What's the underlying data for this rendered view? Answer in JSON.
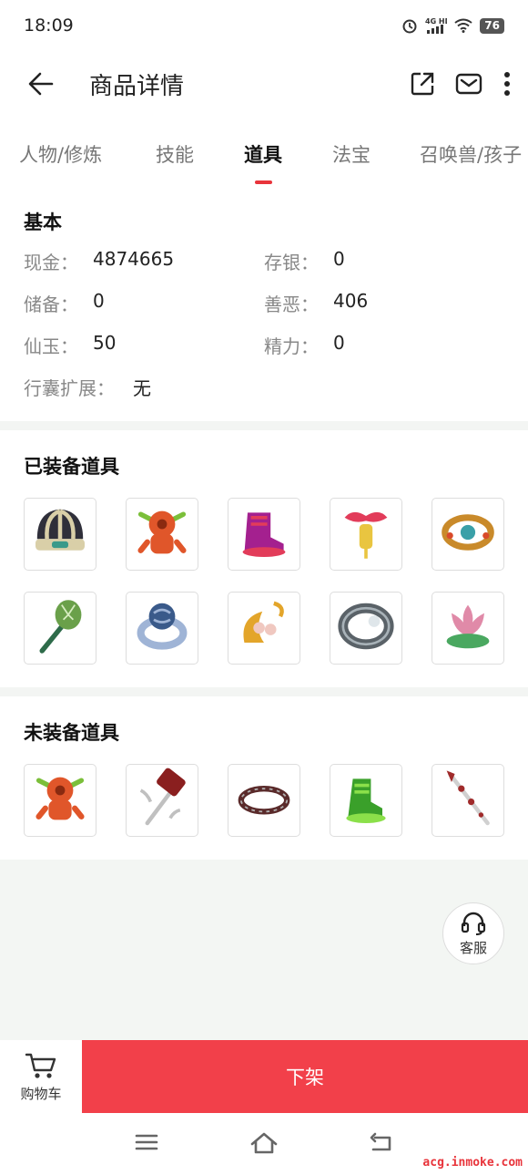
{
  "status_bar": {
    "time": "18:09",
    "network": "4G HD",
    "battery": "76"
  },
  "header": {
    "title": "商品详情"
  },
  "tabs": [
    {
      "label": "人物/修炼"
    },
    {
      "label": "技能"
    },
    {
      "label": "道具"
    },
    {
      "label": "法宝"
    },
    {
      "label": "召唤兽/孩子"
    }
  ],
  "basic": {
    "title": "基本",
    "fields": [
      {
        "label": "现金：",
        "value": "4874665"
      },
      {
        "label": "存银：",
        "value": "0"
      },
      {
        "label": "储备：",
        "value": "0"
      },
      {
        "label": "善恶：",
        "value": "406"
      },
      {
        "label": "仙玉：",
        "value": "50"
      },
      {
        "label": "精力：",
        "value": "0"
      },
      {
        "label": "行囊扩展：",
        "value": "无"
      }
    ]
  },
  "equipped": {
    "title": "已装备道具",
    "items": [
      {
        "icon": "helmet-icon",
        "colors": [
          "#2f2f3a",
          "#d9cfa8"
        ]
      },
      {
        "icon": "beast-totem-icon",
        "colors": [
          "#e0562a",
          "#7bbf3a"
        ]
      },
      {
        "icon": "boots-icon",
        "colors": [
          "#a4208f",
          "#e23c5a"
        ]
      },
      {
        "icon": "pendant-icon",
        "colors": [
          "#e23c5a",
          "#e9c540"
        ]
      },
      {
        "icon": "bracelet-icon",
        "colors": [
          "#c98a2a",
          "#3aa0a8"
        ]
      },
      {
        "icon": "scepter-icon",
        "colors": [
          "#6aa04a",
          "#2e6b4a"
        ]
      },
      {
        "icon": "ring-blue-icon",
        "colors": [
          "#3a5a8a",
          "#9fb4d6"
        ]
      },
      {
        "icon": "earrings-icon",
        "colors": [
          "#e3a52a",
          "#f0c8c0"
        ]
      },
      {
        "icon": "ring-silver-icon",
        "colors": [
          "#5a6268",
          "#a8b2b8"
        ]
      },
      {
        "icon": "lotus-icon",
        "colors": [
          "#e08aa8",
          "#4aa860"
        ]
      }
    ]
  },
  "unequipped": {
    "title": "未装备道具",
    "items": [
      {
        "icon": "beast-totem-icon",
        "colors": [
          "#e0562a",
          "#7bbf3a"
        ]
      },
      {
        "icon": "hammer-icon",
        "colors": [
          "#8a1f1f",
          "#c0c0c0"
        ]
      },
      {
        "icon": "ring-dark-icon",
        "colors": [
          "#5a2a2a",
          "#b0b0b0"
        ]
      },
      {
        "icon": "green-boots-icon",
        "colors": [
          "#3aa02a",
          "#8be04a"
        ]
      },
      {
        "icon": "spear-icon",
        "colors": [
          "#a02a2a",
          "#d0d0d0"
        ]
      }
    ]
  },
  "service": {
    "label": "客服"
  },
  "bottom": {
    "cart_label": "购物车",
    "delist_label": "下架"
  },
  "watermark": "acg.inmoke.com",
  "colors": {
    "accent": "#e8343b",
    "button": "#f2404a",
    "page_bg": "#f3f6f3"
  }
}
